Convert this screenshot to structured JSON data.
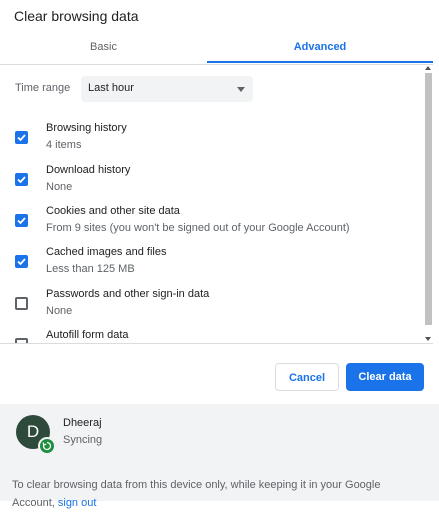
{
  "dialog": {
    "title": "Clear browsing data"
  },
  "tabs": [
    {
      "label": "Basic",
      "active": false
    },
    {
      "label": "Advanced",
      "active": true
    }
  ],
  "time_range": {
    "label": "Time range",
    "value": "Last hour"
  },
  "items": [
    {
      "label": "Browsing history",
      "description": "4 items",
      "checked": true
    },
    {
      "label": "Download history",
      "description": "None",
      "checked": true
    },
    {
      "label": "Cookies and other site data",
      "description": "From 9 sites (you won't be signed out of your Google Account)",
      "checked": true
    },
    {
      "label": "Cached images and files",
      "description": "Less than 125 MB",
      "checked": true
    },
    {
      "label": "Passwords and other sign-in data",
      "description": "None",
      "checked": false
    },
    {
      "label": "Autofill form data",
      "description": "",
      "checked": false
    }
  ],
  "buttons": {
    "cancel": "Cancel",
    "clear": "Clear data"
  },
  "account": {
    "initial": "D",
    "name": "Dheeraj",
    "status": "Syncing"
  },
  "footer": {
    "text": "To clear browsing data from this device only, while keeping it in your Google Account,",
    "link": "sign out"
  },
  "colors": {
    "accent": "#1a73e8",
    "sync": "#1e8e3e"
  },
  "icons": [
    "dropdown-arrow-icon",
    "checkmark-icon",
    "sync-icon"
  ]
}
